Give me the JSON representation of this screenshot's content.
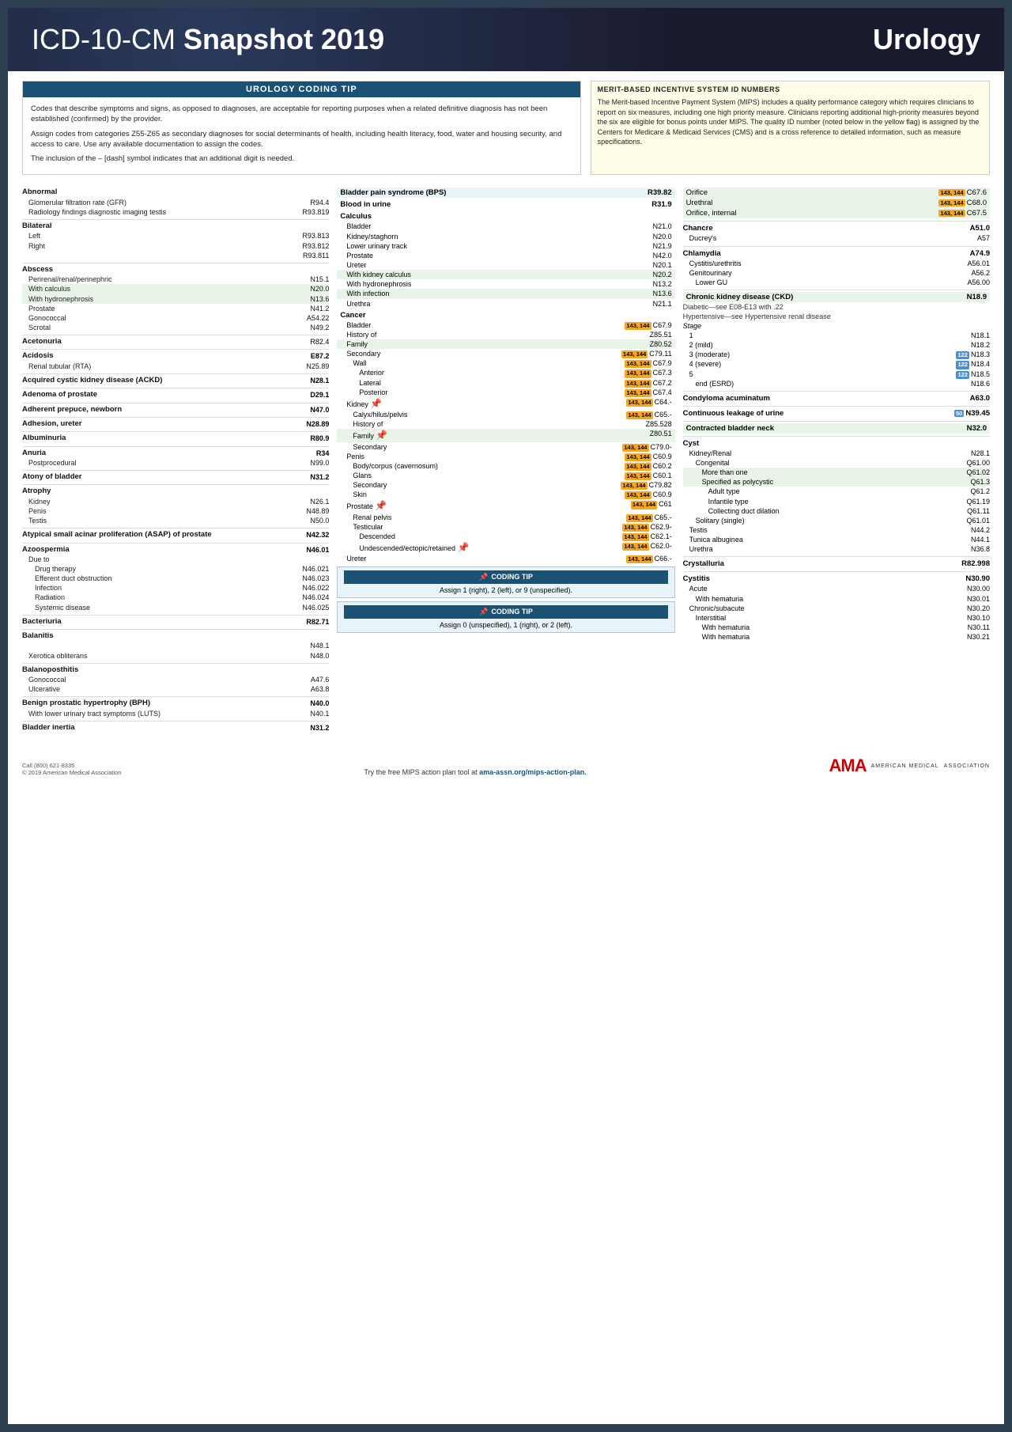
{
  "header": {
    "title_light": "ICD-10-CM ",
    "title_bold": "Snapshot 2019",
    "specialty": "Urology"
  },
  "coding_tip": {
    "header": "UROLOGY CODING TIP",
    "paragraphs": [
      "Codes that describe symptoms and signs, as opposed to diagnoses, are acceptable for reporting purposes when a related definitive diagnosis has not been established (confirmed) by the provider.",
      "Assign codes from categories Z55-Z65 as secondary diagnoses for social determinants of health, including health literacy, food, water and housing security, and access to care. Use any available documentation to assign the codes.",
      "The inclusion of the – [dash] symbol indicates that an additional digit is needed."
    ]
  },
  "mips": {
    "header": "MERIT-BASED INCENTIVE SYSTEM ID NUMBERS",
    "body": "The Merit-based Incentive Payment System (MIPS) includes a quality performance category which requires clinicians to report on six measures, including one high priority measure. Clinicians reporting additional high-priority measures beyond the six are eligible for bonus points under MIPS. The quality ID number (noted below in the yellow flag) is assigned by the Centers for Medicare & Medicaid Services (CMS) and is a cross reference to detailed information, such as measure specifications."
  },
  "left_col": {
    "entries": [
      {
        "main": "Abnormal",
        "subs": [
          {
            "name": "Glomerular filtration rate (GFR)",
            "code": "R94.4"
          },
          {
            "name": "Radiology findings diagnostic imaging testis",
            "code": "R93.819"
          }
        ]
      },
      {
        "main": "Bilateral",
        "subs": [
          {
            "name": "Left",
            "code": "R93.813"
          },
          {
            "name": "Right",
            "code": "R93.812"
          },
          {
            "name": "",
            "code": "R93.811"
          }
        ]
      },
      {
        "main": "Abscess",
        "subs": [
          {
            "name": "Perirenal/renal/perinephric",
            "code": "N15.1"
          }
        ]
      },
      {
        "main": "",
        "subs": [
          {
            "name": "With calculus",
            "code": "N20.0",
            "highlight": true
          },
          {
            "name": "With hydronephrosis",
            "code": "N13.6",
            "highlight": true
          },
          {
            "name": "Prostate",
            "code": "N41.2"
          },
          {
            "name": "Gonococcal",
            "code": "A54.22"
          },
          {
            "name": "Scrotal",
            "code": "N49.2"
          }
        ]
      },
      {
        "main": "Acetonuria",
        "subs": [
          {
            "name": "",
            "code": "R82.4"
          }
        ]
      },
      {
        "main": "Acidosis",
        "subs": [
          {
            "name": "",
            "code": "E87.2"
          },
          {
            "name": "Renal tubular (RTA)",
            "code": "N25.89"
          }
        ]
      },
      {
        "main": "Acquired cystic kidney disease (ACKD)",
        "subs": [
          {
            "name": "",
            "code": "N28.1"
          }
        ]
      },
      {
        "main": "Adenoma of prostate",
        "subs": [
          {
            "name": "",
            "code": "D29.1"
          }
        ]
      },
      {
        "main": "Adherent prepuce, newborn",
        "subs": [
          {
            "name": "",
            "code": "N47.0"
          }
        ]
      },
      {
        "main": "Adhesion, ureter",
        "subs": [
          {
            "name": "",
            "code": "N28.89"
          }
        ]
      },
      {
        "main": "Albuminuria",
        "subs": [
          {
            "name": "",
            "code": "R80.9"
          }
        ]
      },
      {
        "main": "Anuria",
        "subs": [
          {
            "name": "",
            "code": "R34"
          },
          {
            "name": "Postprocedural",
            "code": "N99.0"
          }
        ]
      },
      {
        "main": "Atony of bladder",
        "subs": [
          {
            "name": "",
            "code": "N31.2"
          }
        ]
      },
      {
        "main": "Atrophy",
        "subs": [
          {
            "name": "Kidney",
            "code": "N26.1"
          },
          {
            "name": "Penis",
            "code": "N48.89"
          },
          {
            "name": "Testis",
            "code": "N50.0"
          }
        ]
      },
      {
        "main": "Atypical small acinar proliferation (ASAP) of prostate",
        "subs": [
          {
            "name": "",
            "code": "N42.32"
          }
        ]
      },
      {
        "main": "Azoospermia",
        "subs": [
          {
            "name": "",
            "code": "N46.01"
          },
          {
            "name": "Due to",
            "code": ""
          }
        ]
      },
      {
        "main": "",
        "subs": [
          {
            "name": "Drug therapy",
            "code": "N46.021"
          },
          {
            "name": "Efferent duct obstruction",
            "code": "N46.023"
          },
          {
            "name": "Infection",
            "code": "N46.022"
          },
          {
            "name": "Radiation",
            "code": "N46.024"
          },
          {
            "name": "Systemic disease",
            "code": "N46.025"
          }
        ]
      },
      {
        "main": "Bacteriuria",
        "subs": [
          {
            "name": "",
            "code": "R82.71"
          }
        ]
      },
      {
        "main": "Balanitis",
        "subs": [
          {
            "name": "",
            "code": "N48.1"
          },
          {
            "name": "Xerotica obliterans",
            "code": "N48.0"
          }
        ]
      },
      {
        "main": "Balanoposthitis",
        "subs": [
          {
            "name": "Gonococcal",
            "code": "A47.6"
          },
          {
            "name": "Ulcerative",
            "code": "A63.8"
          }
        ]
      },
      {
        "main": "Benign prostatic hypertrophy (BPH)",
        "subs": [
          {
            "name": "",
            "code": "N40.0"
          },
          {
            "name": "With lower urinary tract symptoms (LUTS)",
            "code": "N40.1"
          }
        ]
      },
      {
        "main": "Bladder inertia",
        "subs": [
          {
            "name": "",
            "code": "N31.2"
          }
        ]
      }
    ]
  },
  "mid_col": {
    "entries": [
      {
        "main": "Bladder pain syndrome (BPS)",
        "code": "R39.82",
        "highlight": true
      },
      {
        "main": "Blood in urine",
        "code": "R31.9",
        "highlight": false
      },
      {
        "main": "Calculus",
        "code": "",
        "subs": [
          {
            "name": "Bladder",
            "code": "N21.0"
          },
          {
            "name": "Kidney/staghorn",
            "code": "N20.0"
          },
          {
            "name": "Lower urinary tract",
            "code": "N21.9"
          },
          {
            "name": "Prostate",
            "code": "N42.0"
          },
          {
            "name": "Ureter",
            "code": "N20.1"
          }
        ]
      },
      {
        "sub": "With kidney calculus",
        "code": "N20.2",
        "highlight": true
      },
      {
        "sub": "With hydronephrosis",
        "code": "N13.2",
        "highlight": false
      },
      {
        "sub": "With infection",
        "code": "N13.6",
        "highlight": true
      },
      {
        "sub": "Urethra",
        "code": "N21.1"
      },
      {
        "main": "Cancer",
        "code": "",
        "subs": [
          {
            "name": "Bladder",
            "code": "143,144 C67.9",
            "badge": true
          }
        ]
      },
      {
        "sub": "History of",
        "code": "Z85.51"
      },
      {
        "sub": "Family",
        "code": "Z80.52",
        "highlight": true
      },
      {
        "sub": "Secondary",
        "code": "143,144 C79.11",
        "badge": true
      },
      {
        "sub2": "Wall",
        "code": "143,144 C67.9",
        "badge": true
      },
      {
        "sub3": "Anterior",
        "code": "143,144 C67.3",
        "badge": true
      },
      {
        "sub3": "Lateral",
        "code": "143,144 C67.2",
        "badge": true
      },
      {
        "sub3": "Posterior",
        "code": "143,144 C67.4",
        "badge": true
      },
      {
        "sub": "Kidney",
        "code": "143,144 C64.-",
        "badge": true,
        "pin": true
      },
      {
        "sub2": "Calyx/hilus/pelvis",
        "code": "143,144 C65.-",
        "badge": true
      },
      {
        "sub2": "History of",
        "code": "Z85.528"
      },
      {
        "sub2": "Family",
        "code": "Z80.51",
        "highlight": true,
        "pin": true
      },
      {
        "sub2": "Secondary",
        "code": "143,144 C79.0-",
        "badge": true
      },
      {
        "sub": "Penis",
        "code": "143,144 C60.9",
        "badge": true
      },
      {
        "sub2": "Body/corpus (cavernosum)",
        "code": "143,144 C60.2",
        "badge": true
      },
      {
        "sub2": "Glans",
        "code": "143,144 C60.1",
        "badge": true
      },
      {
        "sub2": "Secondary",
        "code": "143,144 C79.82",
        "badge": true
      },
      {
        "sub2": "Skin",
        "code": "143,144 C60.9",
        "badge": true
      },
      {
        "sub": "Prostate",
        "code": "143,144 C61",
        "badge": true,
        "pin": true
      },
      {
        "sub2": "Renal pelvis",
        "code": "143,144 C65.-",
        "badge": true
      },
      {
        "sub2": "Testicular",
        "code": "143,144 C62.9-",
        "badge": true
      },
      {
        "sub2": "Descended",
        "code": "143,144 C62.1-",
        "badge": true
      },
      {
        "sub2": "Undescended/ectopic/retained",
        "code": "143,144 C62.0-",
        "badge": true,
        "pin": true
      },
      {
        "sub": "Ureter",
        "code": "143,144 C66.-",
        "badge": true
      }
    ],
    "coding_tips": [
      {
        "header": "CODING TIP",
        "body": "Assign 1 (right), 2 (left), or 9 (unspecified)."
      },
      {
        "header": "CODING TIP",
        "body": "Assign 0 (unspecified), 1 (right), or 2 (left)."
      }
    ]
  },
  "right_col": {
    "entries": [
      {
        "main": "Orifice",
        "code": "143,144 C67.6",
        "badge": true,
        "highlight": true
      },
      {
        "main": "Urethral",
        "code": "143,144 C68.0",
        "badge": true,
        "highlight": true
      },
      {
        "main": "Orifice, internal",
        "code": "143,144 C67.5",
        "badge": true,
        "highlight": true
      },
      {
        "main": "Chancre",
        "code": "A51.0"
      },
      {
        "sub": "Ducrey's",
        "code": "A57"
      },
      {
        "main": "Chlamydia",
        "code": "A74.9"
      },
      {
        "sub": "Cystitis/urethritis",
        "code": "A56.01"
      },
      {
        "sub": "Genitourinary",
        "code": "A56.2"
      },
      {
        "sub2": "Lower GU",
        "code": "A56.00",
        "highlight": true
      },
      {
        "main": "Chronic kidney disease (CKD)",
        "code": "N18.9",
        "highlight": true
      },
      {
        "text": "Diabetic—see E08-E13 with .22"
      },
      {
        "text": "Hypertensive—see Hypertensive renal disease"
      },
      {
        "text": "Stage"
      },
      {
        "sub": "1",
        "code": "N18.1"
      },
      {
        "sub": "2 (mild)",
        "code": "N18.2"
      },
      {
        "sub": "3 (moderate)",
        "code": "122 N18.3",
        "badge2": true
      },
      {
        "sub": "4 (severe)",
        "code": "122 N18.4",
        "badge2": true
      },
      {
        "sub": "5",
        "code": "122 N18.5",
        "badge2": true
      },
      {
        "sub2": "end (ESRD)",
        "code": "N18.6"
      },
      {
        "main": "Condyloma acuminatum",
        "code": "A63.0"
      },
      {
        "main": "Continuous leakage of urine",
        "code": "50 N39.45",
        "badge3": true
      },
      {
        "main": "Contracted bladder neck",
        "code": "N32.0",
        "highlight": true
      },
      {
        "main": "Cyst",
        "code": ""
      },
      {
        "sub": "Kidney/Renal",
        "code": "N28.1"
      },
      {
        "sub2": "Congenital",
        "code": "Q61.00",
        "highlight": true
      },
      {
        "sub3": "More than one",
        "code": "Q61.02",
        "highlight": true
      },
      {
        "sub3": "Specified as polycystic",
        "code": "Q61.3",
        "highlight": true
      },
      {
        "sub4": "Adult type",
        "code": "Q61.2"
      },
      {
        "sub4": "Infantile type",
        "code": "Q61.19"
      },
      {
        "sub4": "Collecting duct dilation",
        "code": "Q61.11",
        "highlight": true
      },
      {
        "sub3": "Solitary (single)",
        "code": "Q61.01"
      },
      {
        "sub": "Testis",
        "code": "N44.2"
      },
      {
        "sub": "Tunica albuginea",
        "code": "N44.1"
      },
      {
        "sub": "Urethra",
        "code": "N36.8"
      },
      {
        "main": "Crystalluria",
        "code": "R82.998"
      },
      {
        "main": "Cystitis",
        "code": "N30.90"
      },
      {
        "sub": "Acute",
        "code": "N30.00"
      },
      {
        "sub2": "With hematuria",
        "code": "N30.01",
        "highlight": true
      },
      {
        "sub": "Chronic/subacute",
        "code": "N30.20"
      },
      {
        "sub2": "Interstitial",
        "code": "N30.10"
      },
      {
        "sub3": "With hematuria",
        "code": "N30.11",
        "highlight": true
      },
      {
        "sub3": "With hematuria",
        "code": "N30.21",
        "highlight": true
      }
    ]
  },
  "footer": {
    "left_line1": "Call (800) 621-8335",
    "left_line2": "© 2019 American Medical Association",
    "center": "Try the free MIPS action plan tool at ama-assn.org/mips-action-plan.",
    "ama_text": "AMA",
    "ama_sub1": "AMERICAN MEDICAL",
    "ama_sub2": "ASSOCIATION"
  }
}
